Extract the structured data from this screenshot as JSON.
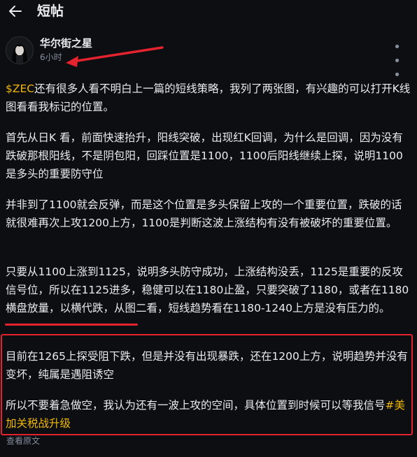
{
  "header": {
    "back_icon": "arrow-left-icon",
    "title": "短帖"
  },
  "post": {
    "author": "华尔街之星",
    "time": "6小时",
    "more_icon": "more-horizontal-icon",
    "ticker": "$ZEC",
    "p1_rest": "还有很多人看不明白上一篇的短线策略，我列了两张图，有兴趣的可以打开K线图看看我标记的位置。",
    "p2": "首先从日K 看，前面快速抬升，阳线突破，出现红K回调，为什么是回调，因为没有跌破那根阳线，不是阴包阳，回踩位置是1100，1100后阳线继续上探，说明1100是多头的重要防守位",
    "p3": "并非到了1100就会反弹，而是这个位置是多头保留上攻的一个重要位置，跌破的话就很难再次上攻1200上方，1100是判断这波上涨结构有没有被破坏的重要位置。",
    "p4": "只要从1100上涨到1125，说明多头防守成功，上涨结构没丢，1125是重要的反攻信号位，所以在1125进多，稳健可以在1180止盈，只要突破了1180，或者在1180横盘放量，以横代跌，从图二看，短线趋势看在1180-1240上方是没有压力的。",
    "p5": "目前在1265上探受阻下跌，但是并没有出现暴跌，还在1200上方，说明趋势并没有变坏，纯属是遇阻诱空",
    "p6_text": "所以不要着急做空，我认为还有一波上攻的空间，具体位置到时候可以等我信号",
    "p6_hashtag": "#美加关税战升级",
    "view_original": "查看原文"
  },
  "colors": {
    "background": "#0d0e12",
    "text": "#eaecef",
    "muted": "#848e9c",
    "accent": "#f0b90b",
    "annotation_red": "#e5232e"
  }
}
